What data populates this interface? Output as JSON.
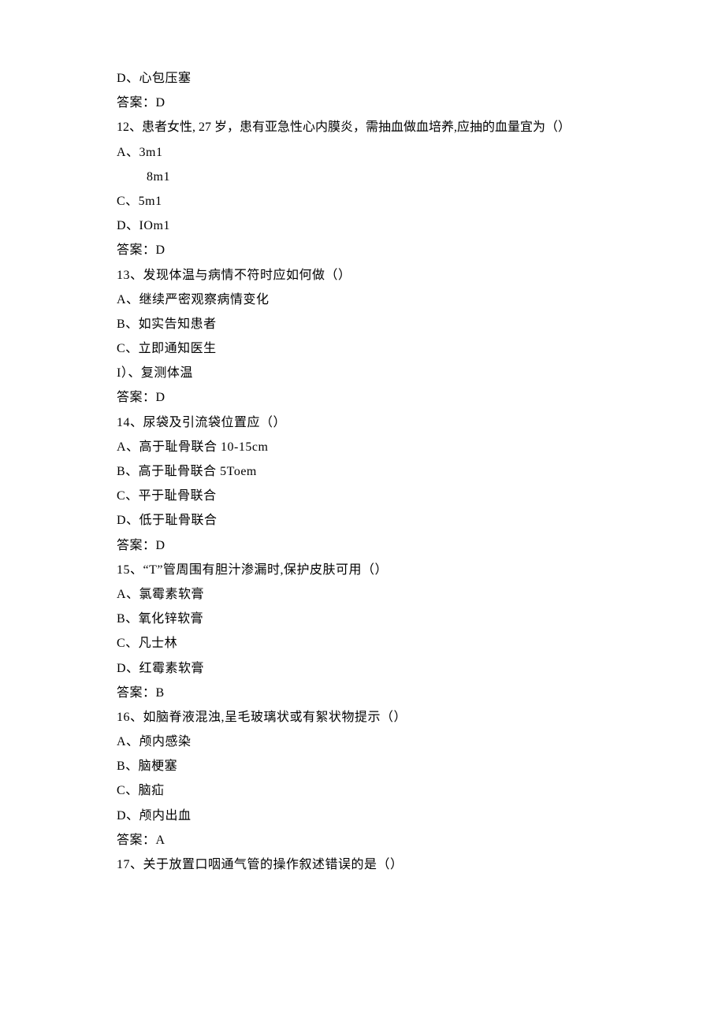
{
  "q11": {
    "optD": "D、心包压塞",
    "answer": "答案：D"
  },
  "q12": {
    "stem": "12、患者女性, 27 岁，患有亚急性心内膜炎，需抽血做血培养,应抽的血量宜为（）",
    "optA": "A、3m1",
    "optB": "8m1",
    "optC": "C、5m1",
    "optD": "D、IOm1",
    "answer": "答案：D"
  },
  "q13": {
    "stem": "13、发现体温与病情不符时应如何做（）",
    "optA": "A、继续严密观察病情变化",
    "optB": "B、如实告知患者",
    "optC": "C、立即通知医生",
    "optD": "I）、复测体温",
    "answer": "答案：D"
  },
  "q14": {
    "stem": "14、尿袋及引流袋位置应（）",
    "optA": "A、高于耻骨联合 10-15cm",
    "optB": "B、高于耻骨联合 5Toem",
    "optC": "C、平于耻骨联合",
    "optD": "D、低于耻骨联合",
    "answer": "答案：D"
  },
  "q15": {
    "stem": "15、“T”管周围有胆汁渗漏时,保护皮肤可用（）",
    "optA": "A、氯霉素软膏",
    "optB": "B、氧化锌软膏",
    "optC": "C、凡士林",
    "optD": "D、红霉素软膏",
    "answer": "答案：B"
  },
  "q16": {
    "stem": "16、如脑脊液混浊,呈毛玻璃状或有絮状物提示（）",
    "optA": "A、颅内感染",
    "optB": "B、脑梗塞",
    "optC": "C、脑疝",
    "optD": "D、颅内出血",
    "answer": "答案：A"
  },
  "q17": {
    "stem": "17、关于放置口咽通气管的操作叙述错误的是（）"
  }
}
